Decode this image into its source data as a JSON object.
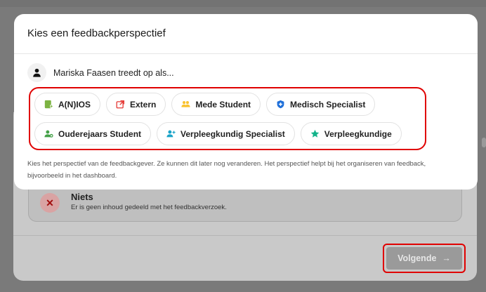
{
  "modal": {
    "title": "Kies een feedbackperspectief",
    "user_name": "Mariska Faasen",
    "user_suffix": " treedt op als...",
    "perspectives": [
      {
        "label": "A(N)IOS",
        "icon": "doctor-badge-icon",
        "color": "#7cb342"
      },
      {
        "label": "Extern",
        "icon": "external-link-icon",
        "color": "#e53935"
      },
      {
        "label": "Mede Student",
        "icon": "users-icon",
        "color": "#f9c22e"
      },
      {
        "label": "Medisch Specialist",
        "icon": "medical-shield-icon",
        "color": "#1e6fd9"
      },
      {
        "label": "Ouderejaars Student",
        "icon": "user-plus-icon",
        "color": "#43a047"
      },
      {
        "label": "Verpleegkundig Specialist",
        "icon": "user-add-icon",
        "color": "#1aa3c8"
      },
      {
        "label": "Verpleegkundige",
        "icon": "star-icon",
        "color": "#13b38a"
      }
    ],
    "help_text": "Kies het perspectief van de feedbackgever. Ze kunnen dit later nog veranderen. Het perspectief helpt bij het organiseren van feedback, bijvoorbeeld in het dashboard."
  },
  "background": {
    "shared_title": "Niets",
    "shared_sub": "Er is geen inhoud gedeeld met het feedbackverzoek.",
    "next_label": "Volgende",
    "next_arrow": "→"
  },
  "colors": {
    "highlight": "#e00000",
    "overlay": "#7a7a7a"
  }
}
